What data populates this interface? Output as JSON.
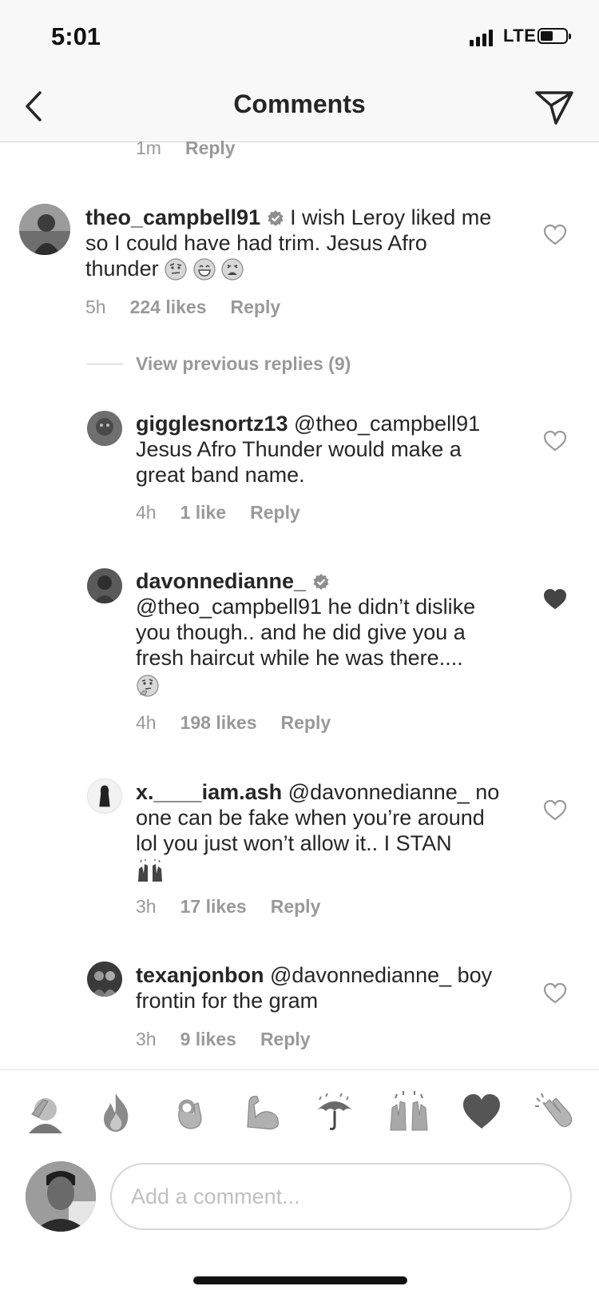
{
  "status_bar": {
    "time": "5:01",
    "network": "LTE"
  },
  "header": {
    "title": "Comments"
  },
  "top_partial": {
    "time": "1m",
    "reply": "Reply"
  },
  "comments": [
    {
      "username": "theo_campbell91",
      "verified": true,
      "text_lines": [
        "I wish Leroy liked me",
        "so I could have had trim. Jesus Afro",
        "thunder"
      ],
      "emojis": [
        "face-with-raised-eyebrow",
        "grinning-face",
        "weary-face"
      ],
      "time": "5h",
      "likes": "224 likes",
      "reply": "Reply",
      "liked": false
    },
    {
      "username": "gigglesnortz13",
      "verified": false,
      "text_lines": [
        "@theo_campbell91",
        "Jesus Afro Thunder would make a",
        "great band name."
      ],
      "time": "4h",
      "likes": "1 like",
      "reply": "Reply",
      "liked": false
    },
    {
      "username": "davonnedianne_",
      "verified": true,
      "text_lines": [
        "@theo_campbell91 he didn’t dislike",
        "you though.. and he did give you a",
        "fresh haircut while he was there...."
      ],
      "emojis": [
        "thinking-face"
      ],
      "time": "4h",
      "likes": "198 likes",
      "reply": "Reply",
      "liked": true
    },
    {
      "username": "x.____iam.ash",
      "verified": false,
      "text_lines": [
        "@davonnedianne_ no",
        "one can be fake when you’re around",
        "lol you just won’t allow it.. I STAN"
      ],
      "emojis": [
        "raising-hands"
      ],
      "time": "3h",
      "likes": "17 likes",
      "reply": "Reply",
      "liked": false
    },
    {
      "username": "texanjonbon",
      "verified": false,
      "text_lines": [
        "@davonnedianne_ boy",
        "frontin for the gram"
      ],
      "time": "3h",
      "likes": "9 likes",
      "reply": "Reply",
      "liked": false
    }
  ],
  "view_previous_replies": "View previous replies (9)",
  "quick_reactions": [
    "facepalm",
    "fire",
    "ok-hand",
    "flexed-biceps",
    "umbrella-with-rain",
    "raising-hands",
    "black-heart",
    "clapping-hands"
  ],
  "composer": {
    "placeholder": "Add a comment..."
  }
}
